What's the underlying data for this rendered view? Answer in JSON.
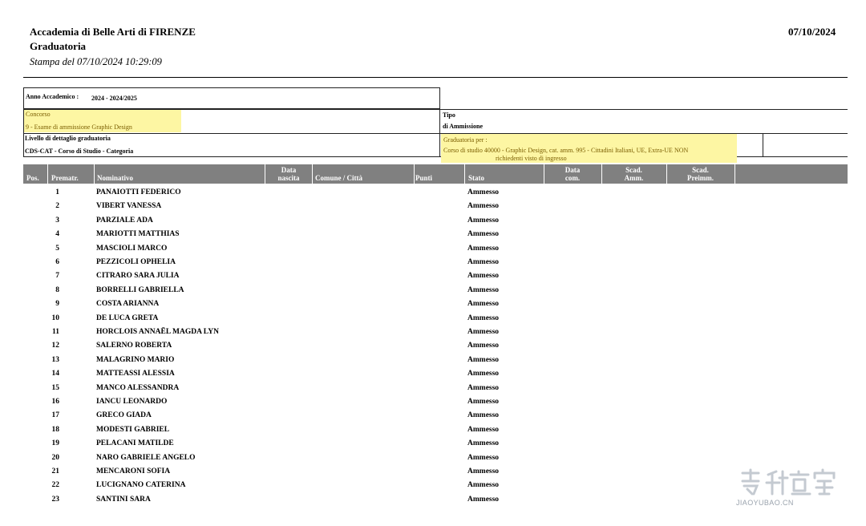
{
  "header": {
    "institution": "Accademia di Belle Arti di FIRENZE",
    "title": "Graduatoria",
    "print_info": "Stampa del 07/10/2024 10:29:09",
    "date": "07/10/2024"
  },
  "info": {
    "anno_label": "Anno Accademico :",
    "anno_value": "2024  -  2024/2025",
    "concorso_label": "Concorso",
    "concorso_value": "9  -  Esame di ammissione Graphic Design",
    "tipo_label": "Tipo",
    "tipo_value": "di Ammissione",
    "livello_label": "Livello di dettaglio graduatoria",
    "livello_value": "CDS-CAT  -  Corso di Studio - Categoria",
    "graduatoria_label": "Graduatoria per :",
    "graduatoria_value_1": "Corso di studio  40000 - Graphic Design, cat. amm. 995 - Cittadini Italiani, UE, Extra-UE NON",
    "graduatoria_value_2": "richiedenti visto di ingresso"
  },
  "columns": {
    "pos": "Pos.",
    "prematr": "Prematr.",
    "nominativo": "Nominativo",
    "data_nascita_1": "Data",
    "data_nascita_2": "nascita",
    "comune": "Comune / Città",
    "punti": "Punti",
    "stato": "Stato",
    "data_com_1": "Data",
    "data_com_2": "com.",
    "scad_amm_1": "Scad.",
    "scad_amm_2": "Amm.",
    "scad_preimm_1": "Scad.",
    "scad_preimm_2": "Preimm."
  },
  "rows": [
    {
      "pos": "1",
      "nome": "PANAIOTTI  FEDERICO",
      "stato": "Ammesso"
    },
    {
      "pos": "2",
      "nome": "VIBERT  VANESSA",
      "stato": "Ammesso"
    },
    {
      "pos": "3",
      "nome": "PARZIALE  ADA",
      "stato": "Ammesso"
    },
    {
      "pos": "4",
      "nome": "MARIOTTI  MATTHIAS",
      "stato": "Ammesso"
    },
    {
      "pos": "5",
      "nome": "MASCIOLI  MARCO",
      "stato": "Ammesso"
    },
    {
      "pos": "6",
      "nome": "PEZZICOLI  OPHELIA",
      "stato": "Ammesso"
    },
    {
      "pos": "7",
      "nome": "CITRARO  SARA JULIA",
      "stato": "Ammesso"
    },
    {
      "pos": "8",
      "nome": "BORRELLI  GABRIELLA",
      "stato": "Ammesso"
    },
    {
      "pos": "9",
      "nome": "COSTA  ARIANNA",
      "stato": "Ammesso"
    },
    {
      "pos": "10",
      "nome": "DE LUCA  GRETA",
      "stato": "Ammesso"
    },
    {
      "pos": "11",
      "nome": "HORCLOIS  ANNAËL MAGDA LYN",
      "stato": "Ammesso"
    },
    {
      "pos": "12",
      "nome": "SALERNO  ROBERTA",
      "stato": "Ammesso"
    },
    {
      "pos": "13",
      "nome": "MALAGRINO  MARIO",
      "stato": "Ammesso"
    },
    {
      "pos": "14",
      "nome": "MATTEASSI  ALESSIA",
      "stato": "Ammesso"
    },
    {
      "pos": "15",
      "nome": "MANCO  ALESSANDRA",
      "stato": "Ammesso"
    },
    {
      "pos": "16",
      "nome": "IANCU  LEONARDO",
      "stato": "Ammesso"
    },
    {
      "pos": "17",
      "nome": "GRECO  GIADA",
      "stato": "Ammesso"
    },
    {
      "pos": "18",
      "nome": "MODESTI  GABRIEL",
      "stato": "Ammesso"
    },
    {
      "pos": "19",
      "nome": "PELACANI  MATILDE",
      "stato": "Ammesso"
    },
    {
      "pos": "20",
      "nome": "NARO  GABRIELE ANGELO",
      "stato": "Ammesso"
    },
    {
      "pos": "21",
      "nome": "MENCARONI  SOFIA",
      "stato": "Ammesso"
    },
    {
      "pos": "22",
      "nome": "LUCIGNANO  CATERINA",
      "stato": "Ammesso"
    },
    {
      "pos": "23",
      "nome": "SANTINI  SARA",
      "stato": "Ammesso"
    }
  ],
  "watermark": {
    "text": "JIAOYUBAO.CN",
    "icon": "jiaoyubao-logo"
  },
  "colors": {
    "header_bar": "#808080",
    "highlight": "#fdf6a3"
  }
}
